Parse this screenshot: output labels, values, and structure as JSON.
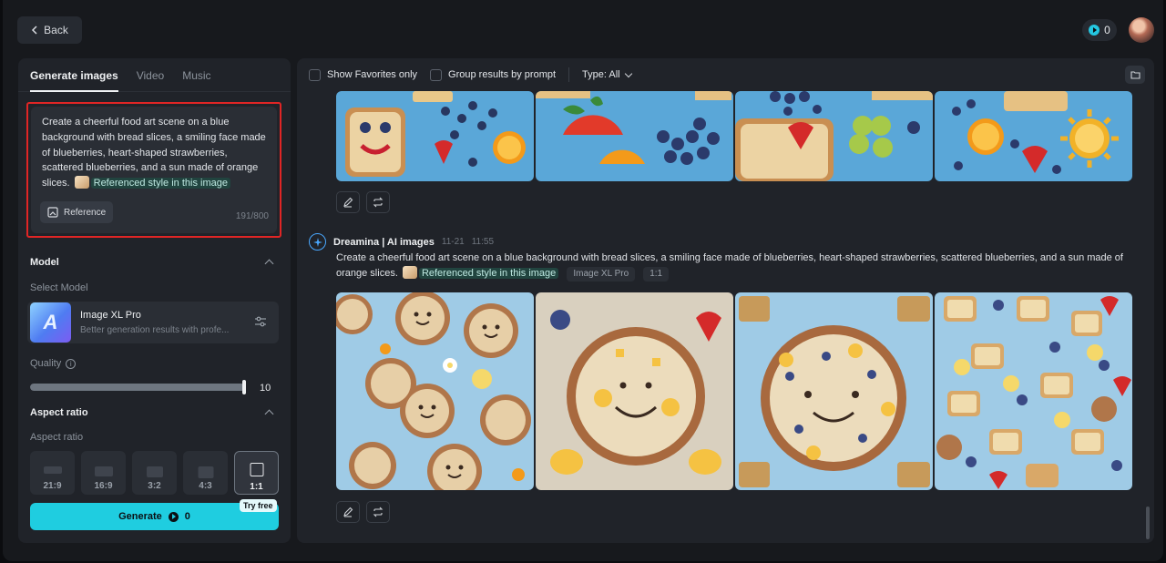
{
  "header": {
    "back_label": "Back",
    "credits": "0"
  },
  "left_panel": {
    "tabs": [
      {
        "label": "Generate images",
        "active": true
      },
      {
        "label": "Video",
        "active": false
      },
      {
        "label": "Music",
        "active": false
      }
    ],
    "prompt": {
      "text": "Create a cheerful food art scene on a blue background with bread slices, a smiling face made of blueberries, heart-shaped strawberries, scattered blueberries, and a sun made of orange slices.",
      "reference_tag": "Referenced style in this image",
      "reference_button": "Reference",
      "char_count": "191/800"
    },
    "model_section": {
      "title": "Model",
      "select_label": "Select Model",
      "model_name": "Image XL Pro",
      "model_desc": "Better generation results with profe..."
    },
    "quality": {
      "label": "Quality",
      "value": "10"
    },
    "aspect_section": {
      "title": "Aspect ratio",
      "label": "Aspect ratio",
      "options": [
        "21:9",
        "16:9",
        "3:2",
        "4:3",
        "1:1"
      ],
      "selected": "1:1"
    },
    "generate": {
      "label": "Generate",
      "cost": "0",
      "badge": "Try free"
    }
  },
  "right_panel": {
    "filters": {
      "favorites": "Show Favorites only",
      "group": "Group results by prompt",
      "type": "Type: All"
    },
    "generation": {
      "author": "Dreamina | AI images",
      "date": "11-21",
      "time": "11:55",
      "prompt": "Create a cheerful food art scene on a blue background with bread slices, a smiling face made of blueberries, heart-shaped strawberries, scattered blueberries, and a sun made of orange slices.",
      "reference_tag": "Referenced style in this image",
      "model_chip": "Image XL Pro",
      "ratio_chip": "1:1"
    }
  },
  "colors": {
    "accent": "#1fcde0",
    "highlight_border": "#e02525",
    "panel": "#202329",
    "background": "#17191d"
  }
}
